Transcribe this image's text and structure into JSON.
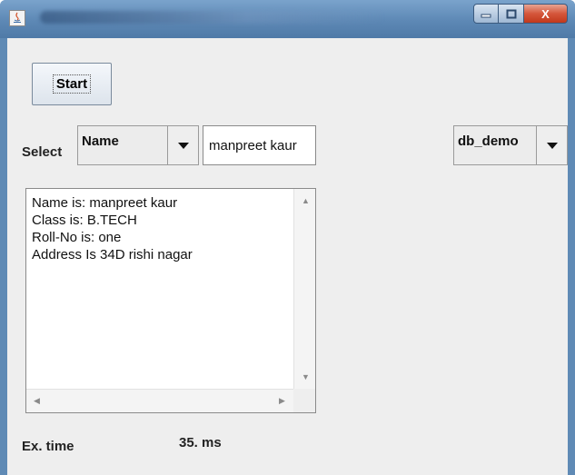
{
  "window": {
    "close_glyph": "X"
  },
  "toolbar": {
    "start_label": "Start"
  },
  "filter": {
    "select_label": "Select",
    "field_selected": "Name",
    "search_value": "manpreet kaur",
    "database_selected": "db_demo"
  },
  "output": {
    "lines": [
      "Name is: manpreet kaur",
      "Class is: B.TECH",
      "Roll-No is: one",
      "Address Is 34D rishi nagar"
    ]
  },
  "status": {
    "exec_label": "Ex. time",
    "exec_value": "35. ms"
  },
  "colors": {
    "titlebar": "#5d88b5",
    "client_bg": "#eeeeee",
    "close_button": "#c1381c"
  }
}
